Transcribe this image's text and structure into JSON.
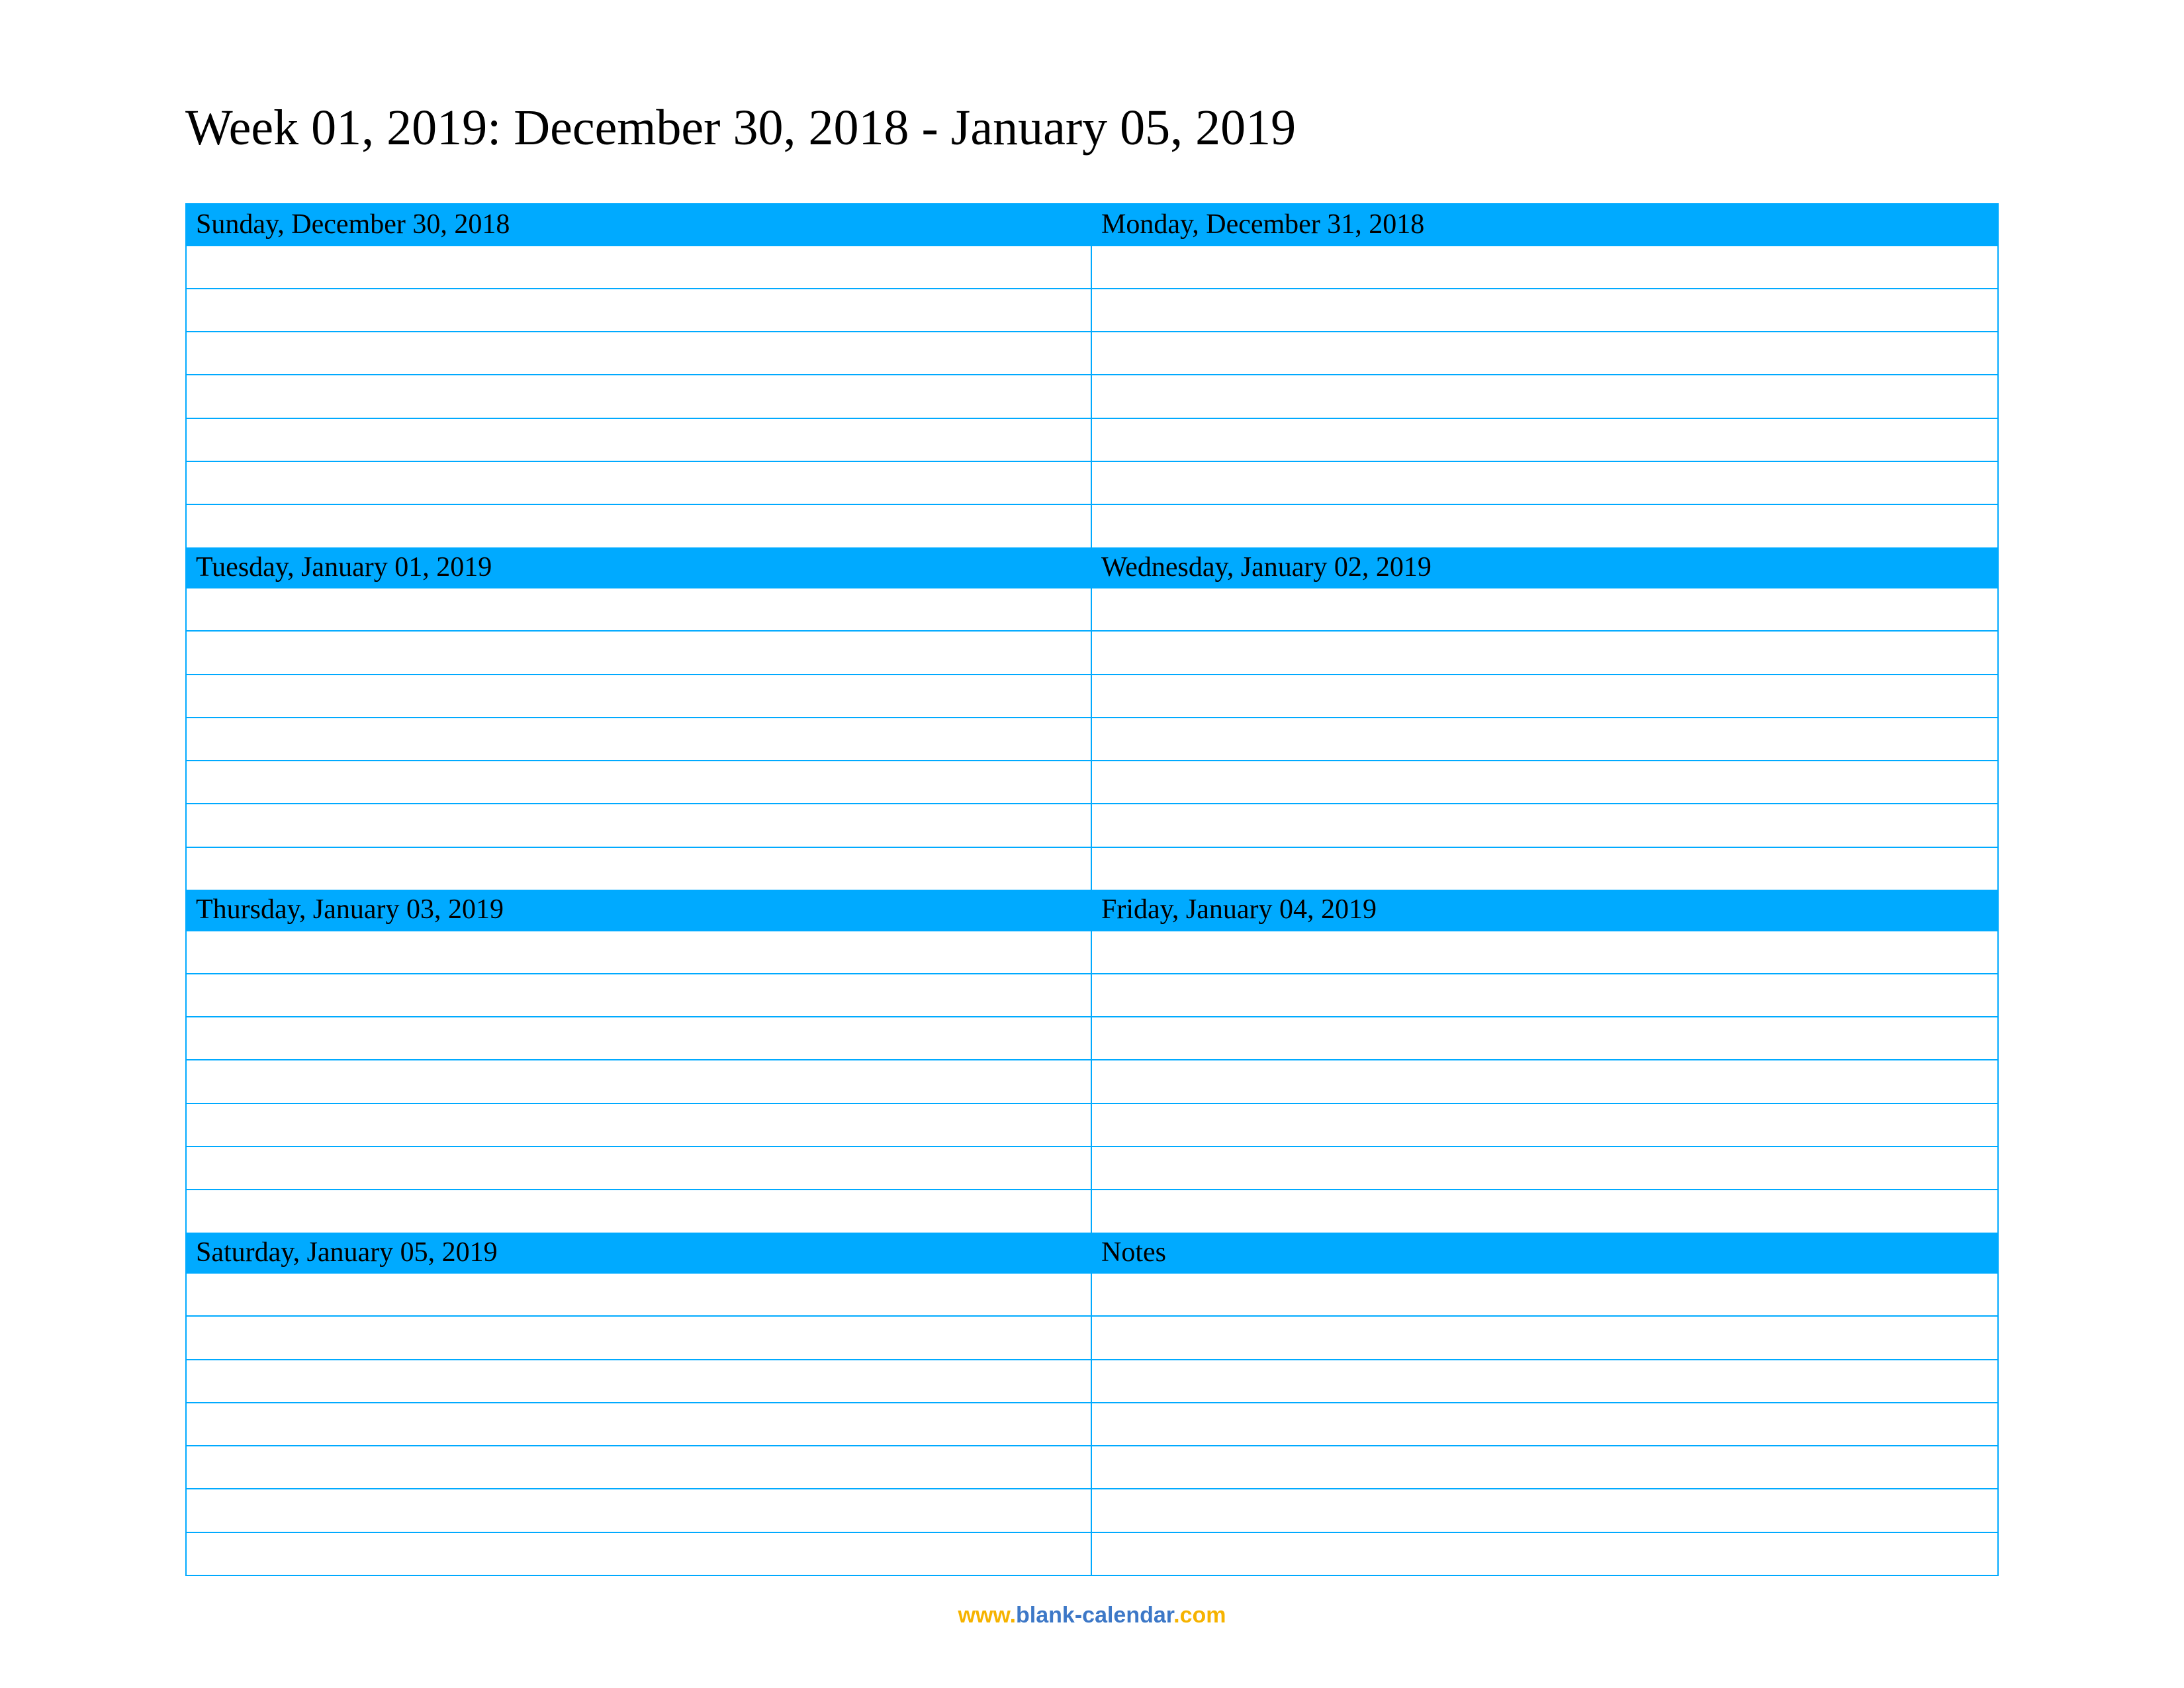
{
  "title": "Week 01, 2019: December 30, 2018 - January 05, 2019",
  "colors": {
    "accent": "#00aaff",
    "footer_yellow": "#f6b300",
    "footer_blue": "#3d78c7"
  },
  "rows_per_block": 7,
  "blocks": [
    {
      "header": "Sunday, December 30, 2018"
    },
    {
      "header": "Monday, December 31, 2018"
    },
    {
      "header": "Tuesday, January 01, 2019"
    },
    {
      "header": "Wednesday, January 02, 2019"
    },
    {
      "header": "Thursday, January 03, 2019"
    },
    {
      "header": "Friday, January 04, 2019"
    },
    {
      "header": "Saturday, January 05, 2019"
    },
    {
      "header": "Notes"
    }
  ],
  "footer": {
    "www": "www.",
    "domain": "blank-calendar",
    "dotcom": ".com"
  }
}
